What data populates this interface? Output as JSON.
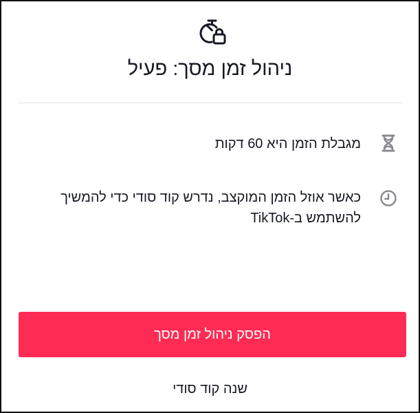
{
  "header": {
    "icon": "timer-lock-icon",
    "title": "ניהול זמן מסך: פעיל"
  },
  "info": [
    {
      "icon": "hourglass-icon",
      "text": "מגבלת הזמן היא 60 דקות"
    },
    {
      "icon": "clock-icon",
      "text": "כאשר אוזל הזמן המוקצב, נדרש קוד סודי כדי להמשיך להשתמש ב-TikTok"
    }
  ],
  "actions": {
    "stop_label": "הפסק ניהול זמן מסך",
    "change_passcode_label": "שנה קוד סודי"
  },
  "colors": {
    "accent": "#fe2c55",
    "icon_gray": "#8a8b91",
    "text": "#161823"
  }
}
